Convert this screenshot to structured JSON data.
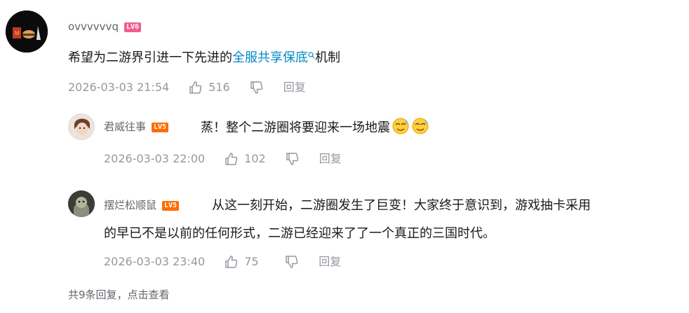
{
  "main_comment": {
    "username": "ovvvvvvq",
    "level": "LV6",
    "text_before": "希望为二游界引进一下先进的",
    "link_text": "全服共享保底",
    "text_after": "机制",
    "time": "2026-03-03 21:54",
    "likes": "516",
    "reply_label": "回复"
  },
  "replies": [
    {
      "username": "君威往事",
      "level": "LV5",
      "text": "蒸！整个二游圈将要迎来一场地震",
      "time": "2026-03-03 22:00",
      "likes": "102",
      "reply_label": "回复"
    },
    {
      "username": "摆烂松顺鼠",
      "level": "LV5",
      "text_line1": "从这一刻开始，二游圈发生了巨变！大家终于意识到，游戏抽卡采用",
      "text_line2": "的早已不是以前的任何形式，二游已经迎来了了一个真正的三国时代。",
      "time": "2026-03-03 23:40",
      "likes": "75",
      "reply_label": "回复"
    }
  ],
  "footer": {
    "text": "共9条回复，点击查看"
  },
  "colors": {
    "link": "#008ac5",
    "meta": "#9499a0",
    "level6": "#f25d8e",
    "level5": "#ff6c00"
  },
  "icons": [
    "thumb-up-icon",
    "thumb-down-icon",
    "search-icon",
    "sweat-emoji-icon"
  ]
}
